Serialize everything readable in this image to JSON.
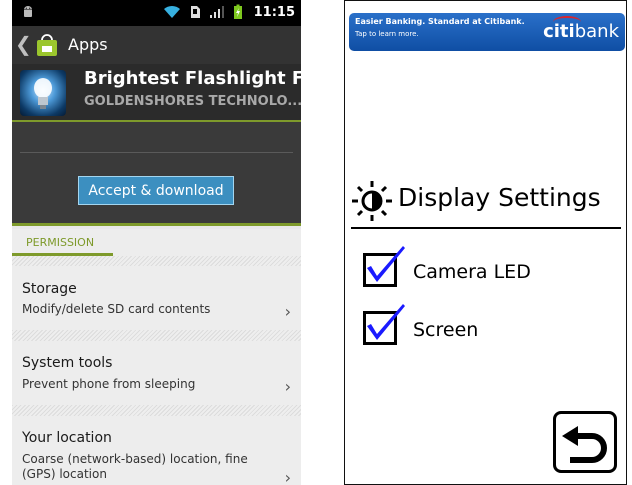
{
  "left_screen": {
    "status_bar": {
      "time": "11:15",
      "icons": [
        "android-icon",
        "wifi-icon",
        "sd-card-icon",
        "signal-icon",
        "battery-charging-icon"
      ]
    },
    "action_bar": {
      "title": "Apps"
    },
    "app": {
      "name": "Brightest Flashlight F",
      "developer": "GOLDENSHORES TECHNOLO..."
    },
    "accept_button": "Accept & download",
    "permission_tab": "PERMISSION",
    "permissions": [
      {
        "title": "Storage",
        "description": "Modify/delete SD card contents"
      },
      {
        "title": "System tools",
        "description": "Prevent phone from sleeping"
      },
      {
        "title": "Your location",
        "description": "Coarse (network-based) location, fine (GPS) location"
      }
    ],
    "colors": {
      "accent_green": "#7e9a2b",
      "button_blue": "#3c8fc0"
    }
  },
  "right_screen": {
    "ad": {
      "line1": "Easier Banking. Standard at Citibank.",
      "line2": "Tap to learn more.",
      "logo": "citibank",
      "logo_bold": "citi",
      "logo_rest": "bank"
    },
    "heading": "Display Settings",
    "options": [
      {
        "label": "Camera LED",
        "checked": true
      },
      {
        "label": "Screen",
        "checked": true
      }
    ],
    "back_icon": "return-arrow-icon",
    "colors": {
      "check_blue": "#1a1aff",
      "ad_blue": "#1b5fb8",
      "citi_red": "#d8262f"
    }
  }
}
